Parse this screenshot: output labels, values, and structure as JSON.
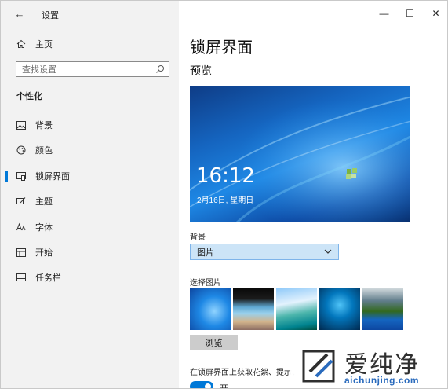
{
  "window": {
    "title": "设置",
    "controls": {
      "minimize": "—",
      "maximize": "☐",
      "close": "✕"
    }
  },
  "sidebar": {
    "back_glyph": "←",
    "home_label": "主页",
    "search_placeholder": "查找设置",
    "section_heading": "个性化",
    "items": [
      {
        "label": "背景",
        "icon": "image-icon"
      },
      {
        "label": "颜色",
        "icon": "palette-icon"
      },
      {
        "label": "锁屏界面",
        "icon": "lock-screen-icon",
        "selected": true
      },
      {
        "label": "主题",
        "icon": "brush-icon"
      },
      {
        "label": "字体",
        "icon": "font-icon"
      },
      {
        "label": "开始",
        "icon": "start-icon"
      },
      {
        "label": "任务栏",
        "icon": "taskbar-icon"
      }
    ]
  },
  "main": {
    "page_title": "锁屏界面",
    "preview_heading": "预览",
    "preview": {
      "time": "16:12",
      "date": "2月16日, 星期日"
    },
    "background_label": "背景",
    "background_value": "图片",
    "choose_picture_label": "选择图片",
    "browse_label": "浏览",
    "tips_label": "在锁屏界面上获取花絮、提示、",
    "toggle_label": "开",
    "toggle_on": true
  },
  "watermark": {
    "title": "爱纯净",
    "url": "aichunjing.com"
  },
  "colors": {
    "accent": "#0078d7",
    "sidebar_bg": "#f2f2f2",
    "select_bg": "#cce4f7"
  }
}
